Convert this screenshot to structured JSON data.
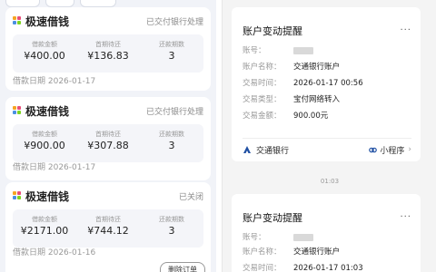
{
  "loans": [
    {
      "title": "极速借钱",
      "status": "已交付银行处理",
      "labels": {
        "amount": "借款金额",
        "first": "首期待还",
        "periods": "还款期数"
      },
      "amount": "¥400.00",
      "first": "¥136.83",
      "periods": "3",
      "date": "借款日期 2026-01-17"
    },
    {
      "title": "极速借钱",
      "status": "已交付银行处理",
      "labels": {
        "amount": "借款金额",
        "first": "首期待还",
        "periods": "还款期数"
      },
      "amount": "¥900.00",
      "first": "¥307.88",
      "periods": "3",
      "date": "借款日期 2026-01-17"
    },
    {
      "title": "极速借钱",
      "status": "已关闭",
      "labels": {
        "amount": "借款金额",
        "first": "首期待还",
        "periods": "还款期数"
      },
      "amount": "¥2171.00",
      "first": "¥744.12",
      "periods": "3",
      "date": "借款日期 2026-01-16",
      "delete_label": "删除订单"
    }
  ],
  "messages": [
    {
      "title": "账户变动提醒",
      "more": "···",
      "rows": [
        {
          "label": "账号：",
          "value": ""
        },
        {
          "label": "账户名称：",
          "value": "交通银行账户"
        },
        {
          "label": "交易时间：",
          "value": "2026-01-17 00:56"
        },
        {
          "label": "交易类型：",
          "value": "宝付网络转入"
        },
        {
          "label": "交易金额：",
          "value": "900.00元"
        }
      ],
      "bank": "交通银行",
      "mini_program": "小程序"
    },
    {
      "title": "账户变动提醒",
      "more": "···",
      "rows": [
        {
          "label": "账号：",
          "value": ""
        },
        {
          "label": "账户名称：",
          "value": "交通银行账户"
        },
        {
          "label": "交易时间：",
          "value": "2026-01-17 01:03"
        }
      ]
    }
  ],
  "divider_time": "01:03",
  "colors": {
    "bank_blue": "#1f4fa3",
    "logo": [
      "#f5a623",
      "#e94e77",
      "#4a90e2",
      "#7ed321"
    ]
  }
}
